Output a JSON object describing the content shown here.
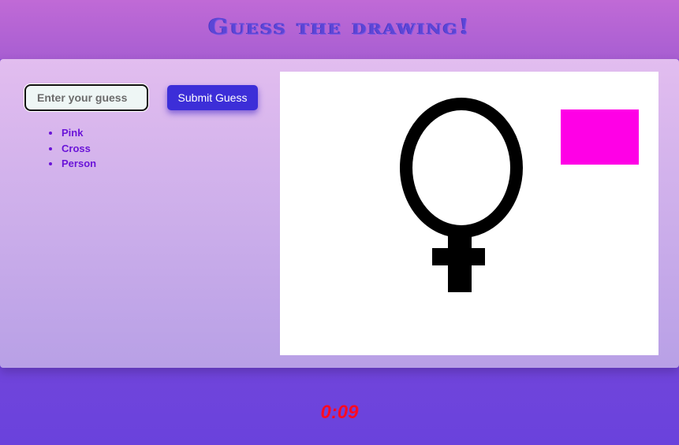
{
  "header": {
    "title": "Guess the drawing!"
  },
  "guess_form": {
    "input_value": "",
    "input_placeholder": "Enter your guess",
    "submit_label": "Submit Guess"
  },
  "guesses": [
    "Pink",
    "Cross",
    "Person"
  ],
  "canvas": {
    "shapes": [
      "female-symbol",
      "magenta-rectangle"
    ],
    "colors": {
      "symbol": "#000000",
      "rectangle": "#ff00e6",
      "background": "#ffffff"
    }
  },
  "timer": {
    "value": "0:09",
    "color": "#ff0a24"
  },
  "colors": {
    "accent": "#3c2ed8",
    "title": "#5b46d6",
    "guess_text": "#6a14d8"
  }
}
